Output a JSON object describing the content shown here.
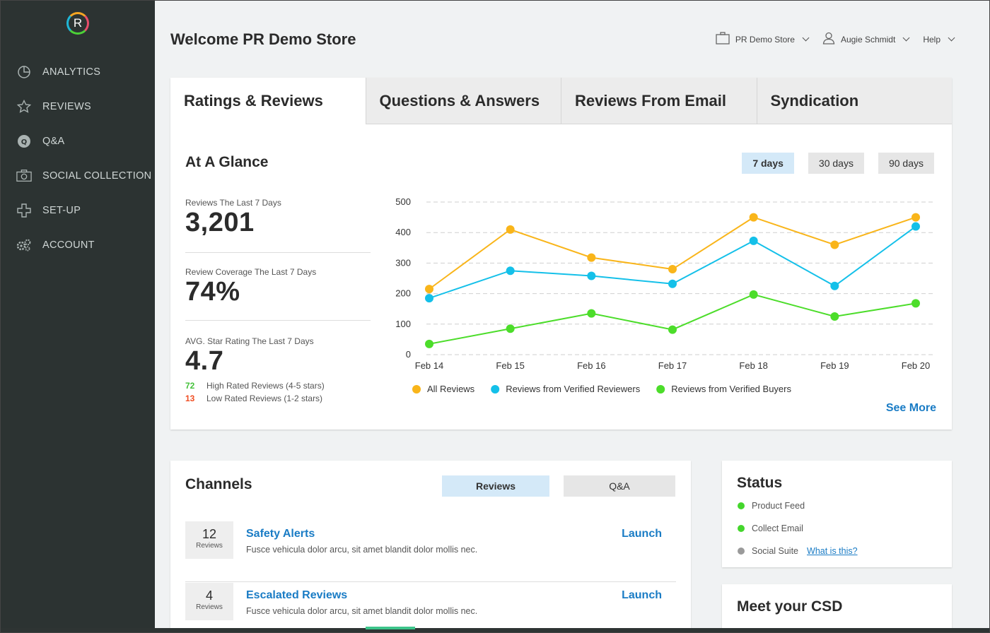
{
  "sidebar": {
    "logo": "R",
    "items": [
      {
        "label": "ANALYTICS",
        "icon": "pie-chart-icon"
      },
      {
        "label": "REVIEWS",
        "icon": "star-icon"
      },
      {
        "label": "Q&A",
        "icon": "qa-icon"
      },
      {
        "label": "SOCIAL COLLECTION",
        "icon": "camera-icon"
      },
      {
        "label": "SET-UP",
        "icon": "puzzle-icon"
      },
      {
        "label": "ACCOUNT",
        "icon": "gears-icon"
      }
    ]
  },
  "header": {
    "welcome": "Welcome PR Demo Store",
    "store": "PR Demo Store",
    "user": "Augie Schmidt",
    "help": "Help"
  },
  "tabs": [
    {
      "label": "Ratings & Reviews",
      "active": true
    },
    {
      "label": "Questions & Answers"
    },
    {
      "label": "Reviews From Email"
    },
    {
      "label": "Syndication"
    }
  ],
  "glance": {
    "title": "At A Glance",
    "ranges": [
      "7 days",
      "30 days",
      "90 days"
    ],
    "active_range": "7 days",
    "stats": [
      {
        "label": "Reviews The Last 7 Days",
        "value": "3,201"
      },
      {
        "label": "Review Coverage The Last 7 Days",
        "value": "74%"
      },
      {
        "label": "AVG. Star Rating The Last 7 Days",
        "value": "4.7"
      }
    ],
    "high_rated": {
      "count": "72",
      "label": "High Rated Reviews (4-5 stars)",
      "color": "#44c13a"
    },
    "low_rated": {
      "count": "13",
      "label": "Low Rated Reviews (1-2 stars)",
      "color": "#f04e23"
    },
    "see_more": "See More"
  },
  "chart_data": {
    "type": "line",
    "categories": [
      "Feb 14",
      "Feb 15",
      "Feb 16",
      "Feb 17",
      "Feb 18",
      "Feb 19",
      "Feb 20"
    ],
    "ylim": [
      0,
      500
    ],
    "yticks": [
      0,
      100,
      200,
      300,
      400,
      500
    ],
    "grid": true,
    "legend_position": "bottom",
    "series": [
      {
        "name": "All Reviews",
        "color": "#f9b51a",
        "values": [
          215,
          410,
          318,
          280,
          450,
          360,
          450
        ]
      },
      {
        "name": "Reviews from Verified Reviewers",
        "color": "#14c0e9",
        "values": [
          185,
          275,
          258,
          232,
          373,
          225,
          420
        ]
      },
      {
        "name": "Reviews from Verified Buyers",
        "color": "#4cdd2a",
        "values": [
          35,
          85,
          135,
          82,
          197,
          125,
          168
        ]
      }
    ]
  },
  "channels": {
    "title": "Channels",
    "toggle_reviews": "Reviews",
    "toggle_qa": "Q&A",
    "rows": [
      {
        "count": "12",
        "unit": "Reviews",
        "name": "Safety Alerts",
        "desc": "Fusce vehicula dolor arcu, sit amet blandit dolor mollis nec.",
        "action": "Launch"
      },
      {
        "count": "4",
        "unit": "Reviews",
        "name": "Escalated Reviews",
        "desc": "Fusce vehicula dolor arcu, sit amet blandit dolor mollis nec.",
        "action": "Launch"
      }
    ]
  },
  "status": {
    "title": "Status",
    "items": [
      {
        "label": "Product Feed",
        "color": "#44d62c"
      },
      {
        "label": "Collect Email",
        "color": "#44d62c"
      },
      {
        "label": "Social Suite",
        "color": "#9a9a9a",
        "link": "What is this?"
      }
    ]
  },
  "csd": {
    "title": "Meet your CSD"
  }
}
